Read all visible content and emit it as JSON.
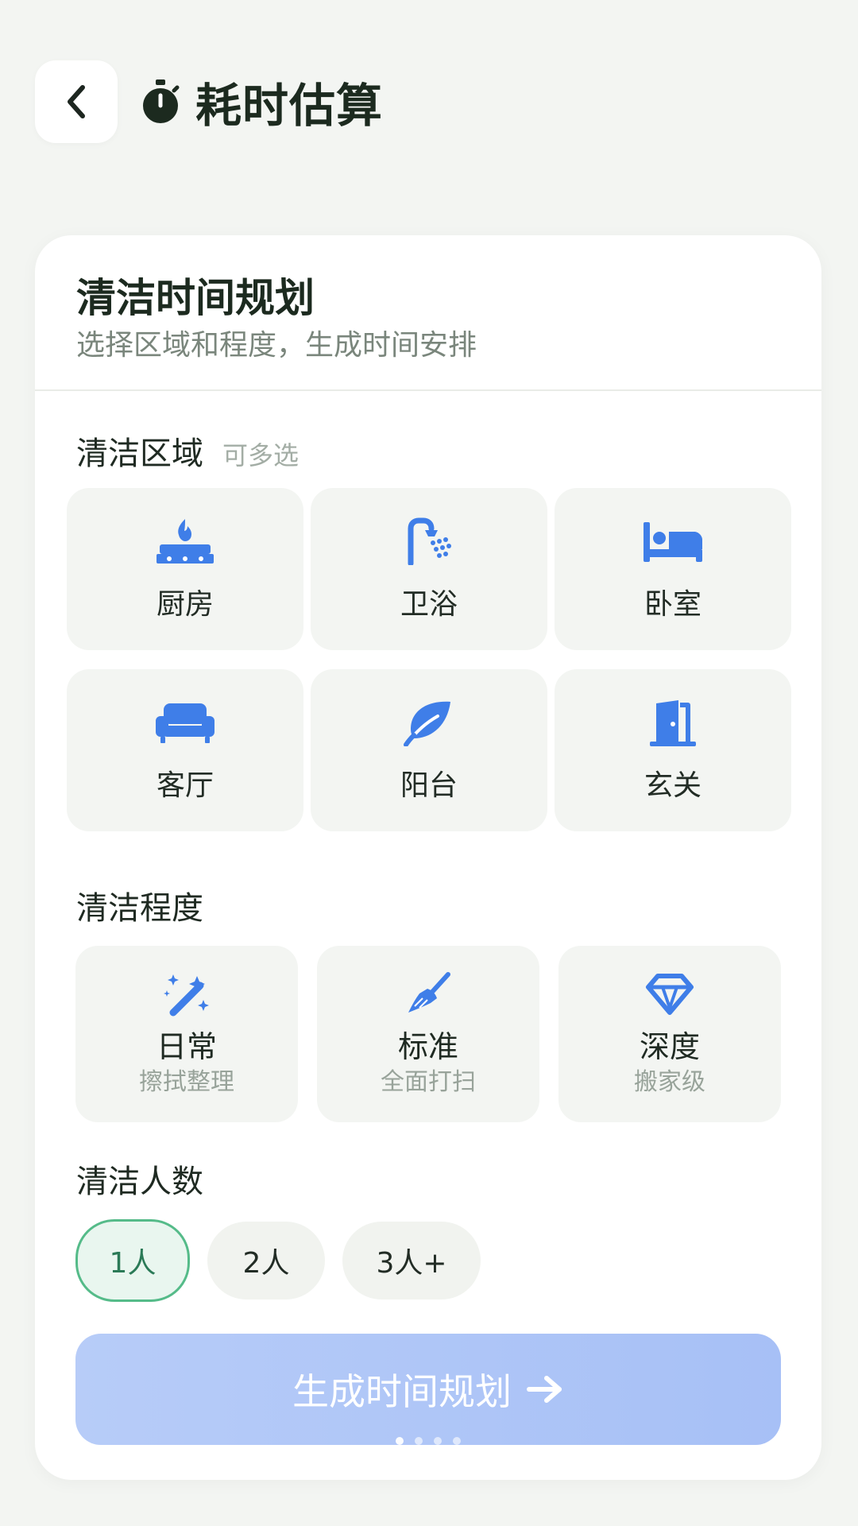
{
  "header": {
    "title": "耗时估算",
    "back_icon": "chevron-left-icon",
    "title_icon": "stopwatch-icon"
  },
  "card": {
    "title": "清洁时间规划",
    "subtitle": "选择区域和程度，生成时间安排"
  },
  "areas": {
    "label": "清洁区域",
    "hint": "可多选",
    "items": [
      {
        "label": "厨房",
        "icon": "stove-fire-icon"
      },
      {
        "label": "卫浴",
        "icon": "shower-icon"
      },
      {
        "label": "卧室",
        "icon": "bed-icon"
      },
      {
        "label": "客厅",
        "icon": "sofa-icon"
      },
      {
        "label": "阳台",
        "icon": "leaf-icon"
      },
      {
        "label": "玄关",
        "icon": "door-icon"
      }
    ]
  },
  "levels": {
    "label": "清洁程度",
    "items": [
      {
        "title": "日常",
        "sub": "擦拭整理",
        "icon": "magic-wand-icon"
      },
      {
        "title": "标准",
        "sub": "全面打扫",
        "icon": "broom-icon"
      },
      {
        "title": "深度",
        "sub": "搬家级",
        "icon": "diamond-icon"
      }
    ]
  },
  "people": {
    "label": "清洁人数",
    "options": [
      "1人",
      "2人",
      "3人+"
    ],
    "selected": "1人"
  },
  "generate": {
    "label": "生成时间规划",
    "icon": "arrow-right-icon"
  },
  "colors": {
    "accent_blue": "#3f7ee8",
    "accent_green": "#55bb89",
    "button_blue": "#a7c0f6"
  }
}
